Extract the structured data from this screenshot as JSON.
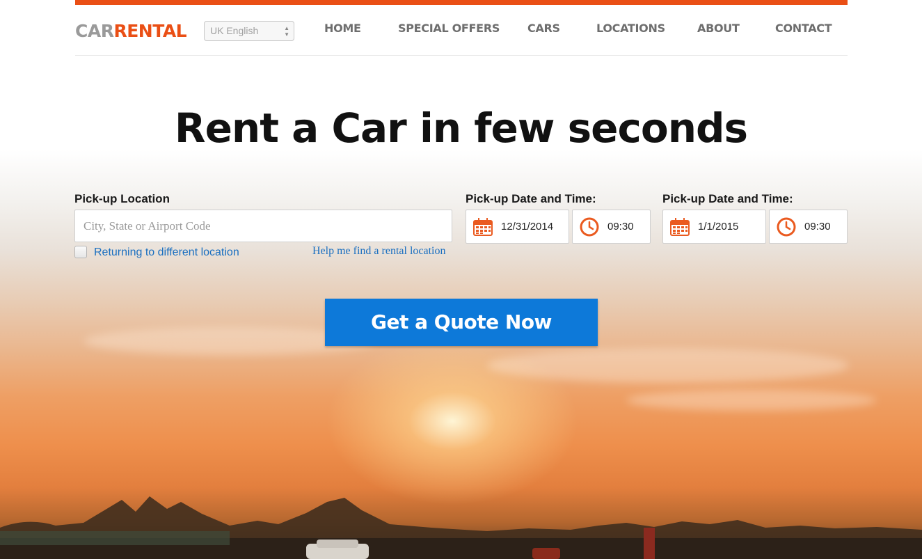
{
  "brand": {
    "logo_part1": "CAR",
    "logo_part2": "RENTAL"
  },
  "language": {
    "selected": "UK English"
  },
  "nav": {
    "items": [
      {
        "label": "HOME"
      },
      {
        "label": "SPECIAL OFFERS"
      },
      {
        "label": "CARS"
      },
      {
        "label": "LOCATIONS"
      },
      {
        "label": "ABOUT"
      },
      {
        "label": "CONTACT"
      }
    ]
  },
  "hero": {
    "title": "Rent a Car in few seconds"
  },
  "form": {
    "location_label": "Pick-up Location",
    "location_placeholder": "City, State or Airport Code",
    "return_checkbox_label": "Returning to different location",
    "help_link": "Help me find a rental location",
    "pickup": {
      "label": "Pick-up Date and Time:",
      "date": "12/31/2014",
      "time": "09:30"
    },
    "dropoff": {
      "label": "Pick-up Date and Time:",
      "date": "1/1/2015",
      "time": "09:30"
    },
    "submit_label": "Get a Quote Now"
  },
  "colors": {
    "accent": "#ea4f15",
    "button": "#0d79d9",
    "link": "#1a6fc0"
  }
}
